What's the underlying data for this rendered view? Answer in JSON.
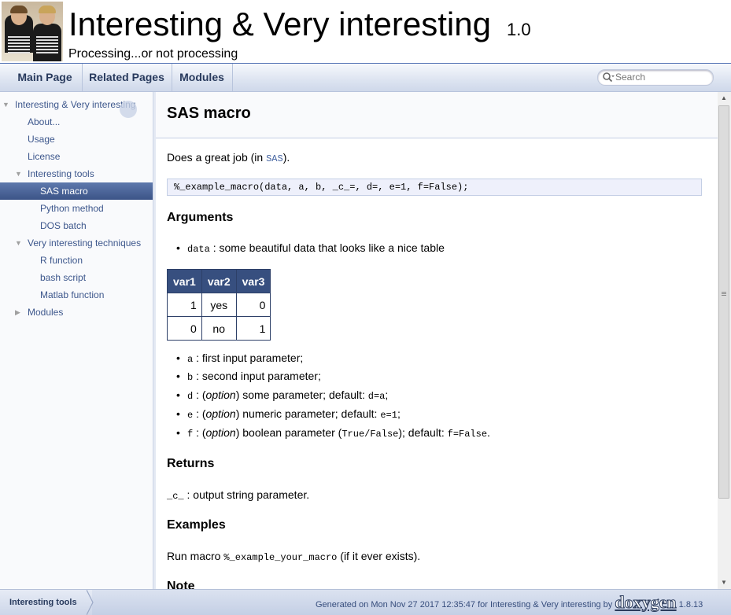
{
  "header": {
    "project_name": "Interesting & Very interesting",
    "project_number": "1.0",
    "project_brief": "Processing...or not processing"
  },
  "navbar": {
    "tabs": [
      "Main Page",
      "Related Pages",
      "Modules"
    ],
    "search_placeholder": "Search"
  },
  "sidenav": {
    "items": [
      {
        "label": "Interesting & Very interesting",
        "arrow": "▼"
      },
      {
        "label": "About..."
      },
      {
        "label": "Usage"
      },
      {
        "label": "License"
      },
      {
        "label": "Interesting tools",
        "arrow": "▼"
      },
      {
        "label": "SAS macro",
        "selected": true
      },
      {
        "label": "Python method"
      },
      {
        "label": "DOS batch"
      },
      {
        "label": "Very interesting techniques",
        "arrow": "▼"
      },
      {
        "label": "R function"
      },
      {
        "label": "bash script"
      },
      {
        "label": "Matlab function"
      },
      {
        "label": "Modules",
        "arrow": "▶"
      }
    ]
  },
  "content": {
    "title": "SAS macro",
    "intro_pre": "Does a great job (in ",
    "intro_code": "SAS",
    "intro_post": ").",
    "code_fragment": "%_example_macro(data, a, b, _c_=, d=, e=1, f=False);",
    "arguments_heading": "Arguments",
    "data_arg_code": "data",
    "data_arg_text": " : some beautiful data that looks like a nice table",
    "table": {
      "headers": [
        "var1",
        "var2",
        "var3"
      ],
      "rows": [
        [
          "1",
          "yes",
          "0"
        ],
        [
          "0",
          "no",
          "1"
        ]
      ]
    },
    "params": [
      {
        "code": "a",
        "text": " : first input parameter;"
      },
      {
        "code": "b",
        "text": " : second input parameter;"
      },
      {
        "code": "d",
        "pre": " : (",
        "em": "option",
        "text": ") some parameter; default: ",
        "default": "d=a",
        "end": ";"
      },
      {
        "code": "e",
        "pre": " : (",
        "em": "option",
        "text": ") numeric parameter; default: ",
        "default": "e=1",
        "end": ";"
      },
      {
        "code": "f",
        "pre": " : (",
        "em": "option",
        "text": ") boolean parameter (",
        "mid_code": "True/False",
        "text2": "); default: ",
        "default": "f=False",
        "end": "."
      }
    ],
    "returns_heading": "Returns",
    "returns_code": "_c_",
    "returns_text": " : output string parameter.",
    "examples_heading": "Examples",
    "examples_pre": "Run macro ",
    "examples_code": "%_example_your_macro",
    "examples_post": " (if it ever exists).",
    "note_heading": "Note"
  },
  "footer": {
    "breadcrumb": "Interesting tools",
    "generated_text": "Generated on Mon Nov 27 2017 12:35:47 for Interesting & Very interesting by",
    "doxygen_logo": "doxygen",
    "version": "1.8.13"
  }
}
